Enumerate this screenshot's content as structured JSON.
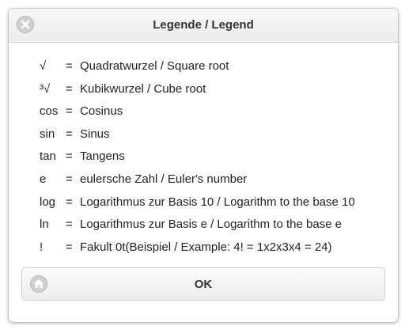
{
  "dialog": {
    "title": "Legende / Legend",
    "close_icon": "close-icon",
    "ok_label": "OK",
    "ok_icon": "home-icon"
  },
  "legend": [
    {
      "symbol": "√",
      "equals": "=",
      "description": "Quadratwurzel / Square root"
    },
    {
      "symbol": "³√",
      "equals": "=",
      "description": "Kubikwurzel / Cube root"
    },
    {
      "symbol": "cos",
      "equals": "=",
      "description": "Cosinus"
    },
    {
      "symbol": "sin",
      "equals": "=",
      "description": "Sinus"
    },
    {
      "symbol": "tan",
      "equals": "=",
      "description": "Tangens"
    },
    {
      "symbol": "e",
      "equals": "=",
      "description": "eulersche Zahl / Euler's number"
    },
    {
      "symbol": "log",
      "equals": "=",
      "description": "Logarithmus zur Basis 10 / Logarithm to the base 10"
    },
    {
      "symbol": "ln",
      "equals": "=",
      "description": "Logarithmus zur Basis e / Logarithm to the base e"
    },
    {
      "symbol": "!",
      "equals": "=",
      "description": "Fakult 0t(Beispiel / Example: 4! = 1x2x3x4 = 24)"
    }
  ]
}
